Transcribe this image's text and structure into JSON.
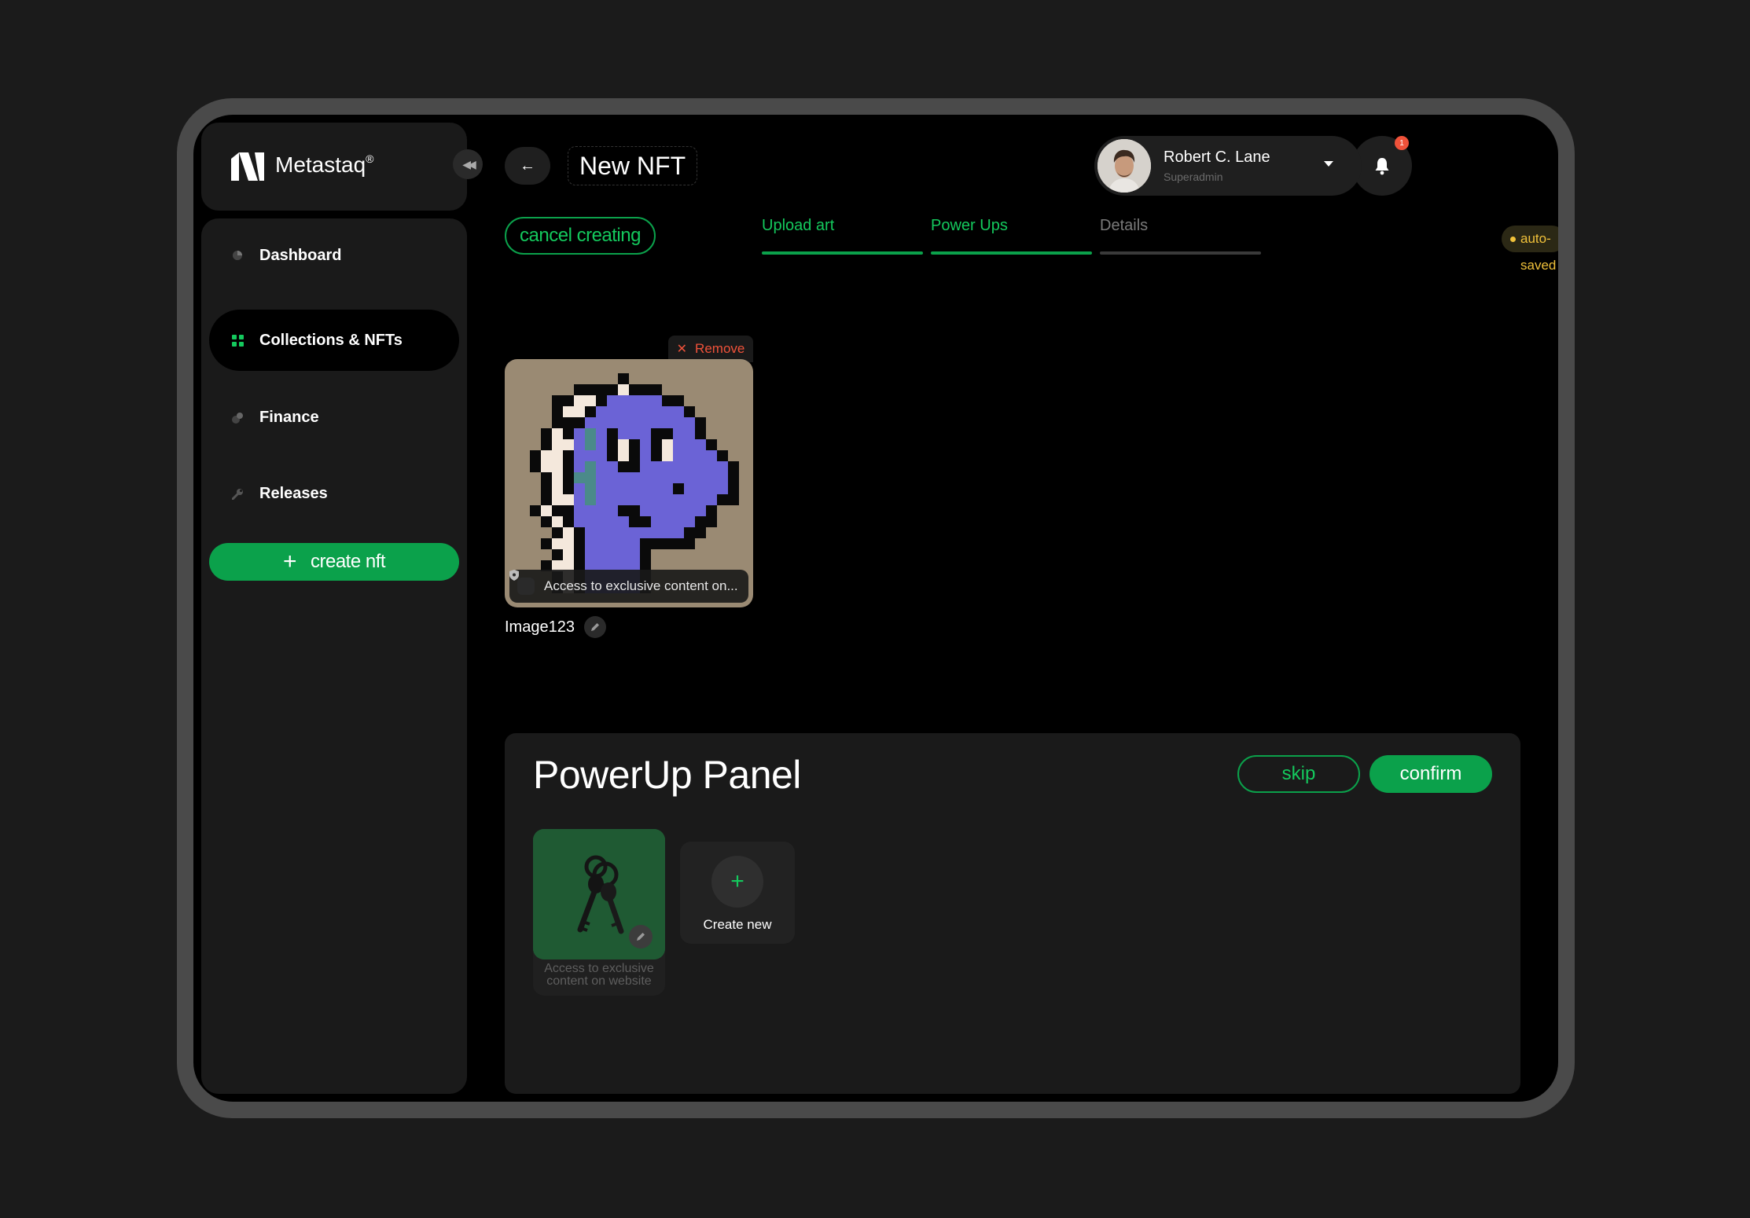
{
  "brand": {
    "name": "Metastaq",
    "mark": "®"
  },
  "sidebar": {
    "items": [
      {
        "label": "Dashboard",
        "icon": "pie-chart-icon",
        "active": false
      },
      {
        "label": "Collections & NFTs",
        "icon": "grid-icon",
        "active": true
      },
      {
        "label": "Finance",
        "icon": "coins-icon",
        "active": false
      },
      {
        "label": "Releases",
        "icon": "wrench-icon",
        "active": false
      }
    ],
    "create_label": "create nft"
  },
  "header": {
    "title": "New NFT",
    "notification_count": "1",
    "user": {
      "name": "Robert C. Lane",
      "role": "Superadmin"
    }
  },
  "wizard": {
    "cancel_label": "cancel creating",
    "steps": [
      {
        "label": "Upload art",
        "state": "done"
      },
      {
        "label": "Power Ups",
        "state": "current"
      },
      {
        "label": "Details",
        "state": "pending"
      }
    ],
    "autosave": "auto-saved"
  },
  "art": {
    "remove_label": "Remove",
    "caption": "Access to exclusive content on...",
    "name": "Image123"
  },
  "panel": {
    "title": "PowerUp Panel",
    "skip_label": "skip",
    "confirm_label": "confirm",
    "powerups": [
      {
        "label": "Access to exclusive content on website"
      }
    ],
    "create_new_label": "Create new"
  },
  "colors": {
    "accent": "#0ba14b",
    "accent_text": "#14c95d",
    "danger": "#f0523a",
    "warning": "#f0c13a",
    "nft_body": "#6b63d6",
    "nft_bg": "#9a8a73"
  }
}
